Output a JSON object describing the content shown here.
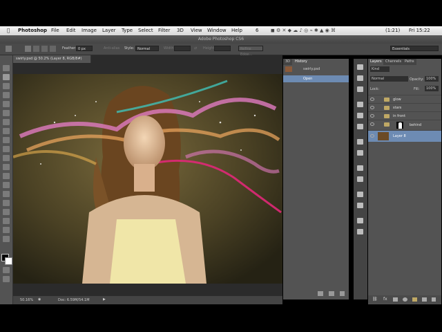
{
  "menubar": {
    "apple": "",
    "app": "Photoshop",
    "items": [
      "File",
      "Edit",
      "Image",
      "Layer",
      "Type",
      "Select",
      "Filter",
      "3D",
      "View",
      "Window",
      "Help"
    ],
    "status": {
      "battery": "(1:21)",
      "clock": "Fri 15:22",
      "adobe": "6"
    }
  },
  "window_title": "Adobe Photoshop CS6",
  "options": {
    "feather_label": "Feather:",
    "feather_value": "0 px",
    "antialias_label": "Anti-alias",
    "style_label": "Style:",
    "style_value": "Normal",
    "width_label": "Width:",
    "height_label": "Height:",
    "refine_label": "Refine Edge...",
    "workspace": "Essentials"
  },
  "document": {
    "tab": "swirly.psd @ 50.2% (Layer 8, RGB/8#)",
    "zoom": "50.16%",
    "doc_size": "Doc: 6.59M/54.1M"
  },
  "history": {
    "tabs": [
      "3D",
      "History"
    ],
    "snapshot": "swirly.psd",
    "item": "Open"
  },
  "layers": {
    "tabs": [
      "Layers",
      "Channels",
      "Paths"
    ],
    "kind": "Kind",
    "blend_mode": "Normal",
    "opacity_label": "Opacity:",
    "opacity_value": "100%",
    "lock_label": "Lock:",
    "fill_label": "Fill:",
    "fill_value": "100%",
    "list": [
      {
        "name": "glow",
        "type": "folder"
      },
      {
        "name": "stars",
        "type": "folder"
      },
      {
        "name": "in front",
        "type": "folder"
      },
      {
        "name": "behind",
        "type": "folder-mask"
      },
      {
        "name": "Layer 8",
        "type": "layer",
        "selected": true
      }
    ]
  },
  "colors": {
    "panel": "#535353",
    "selection": "#6d8bb3",
    "canvas_bg": "#2b2b2b"
  }
}
